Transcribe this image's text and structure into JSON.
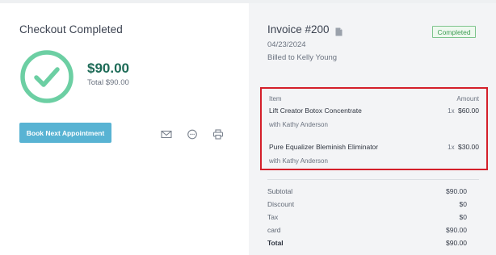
{
  "checkout": {
    "title": "Checkout Completed",
    "amount": "$90.00",
    "total_line": "Total $90.00",
    "book_button": "Book Next Appointment",
    "colors": {
      "check": "#6ccfa3",
      "amount": "#1d6b57",
      "button": "#58b3d3"
    },
    "action_icons": [
      "mail-icon",
      "chat-icon",
      "print-icon"
    ]
  },
  "invoice": {
    "title": "Invoice #200",
    "date": "04/23/2024",
    "billed_to": "Billed to Kelly Young",
    "status": "Completed",
    "items_header": {
      "item": "Item",
      "amount": "Amount"
    },
    "items": [
      {
        "name": "Lift Creator Botox Concentrate",
        "staff": "with Kathy Anderson",
        "qty": "1x",
        "price": "$60.00"
      },
      {
        "name": "Pure Equalizer Bleminish Eliminator",
        "staff": "with Kathy Anderson",
        "qty": "1x",
        "price": "$30.00"
      }
    ],
    "totals": [
      {
        "label": "Subtotal",
        "value": "$90.00"
      },
      {
        "label": "Discount",
        "value": "$0"
      },
      {
        "label": "Tax",
        "value": "$0"
      },
      {
        "label": "card",
        "value": "$90.00"
      },
      {
        "label": "Total",
        "value": "$90.00"
      }
    ]
  }
}
